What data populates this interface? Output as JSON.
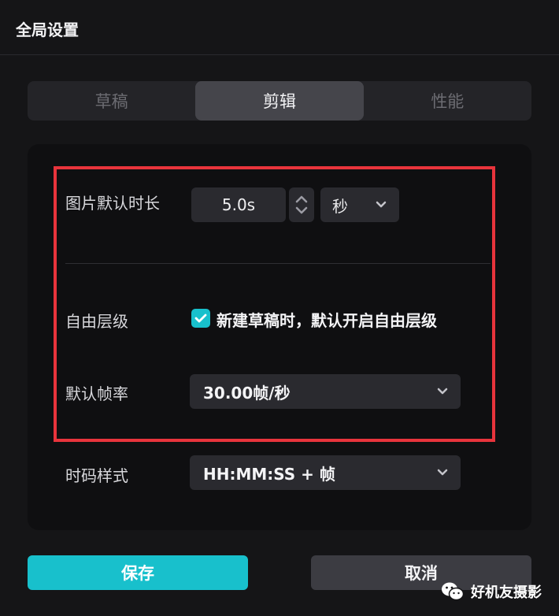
{
  "dialog": {
    "title": "全局设置"
  },
  "tabs": [
    {
      "label": "草稿",
      "active": false
    },
    {
      "label": "剪辑",
      "active": true
    },
    {
      "label": "性能",
      "active": false
    }
  ],
  "settings": {
    "image_duration": {
      "label": "图片默认时长",
      "value": "5.0s",
      "unit": "秒"
    },
    "free_layer": {
      "label": "自由层级",
      "checked": true,
      "checkbox_text": "新建草稿时，默认开启自由层级"
    },
    "default_framerate": {
      "label": "默认帧率",
      "value": "30.00帧/秒"
    },
    "timecode_style": {
      "label": "时码样式",
      "value": "HH:MM:SS + 帧"
    }
  },
  "buttons": {
    "save": "保存",
    "cancel": "取消"
  },
  "watermark": {
    "text": "好机友摄影"
  },
  "colors": {
    "accent": "#18c0cc",
    "highlight_border": "#e8343c",
    "background": "#151517"
  }
}
